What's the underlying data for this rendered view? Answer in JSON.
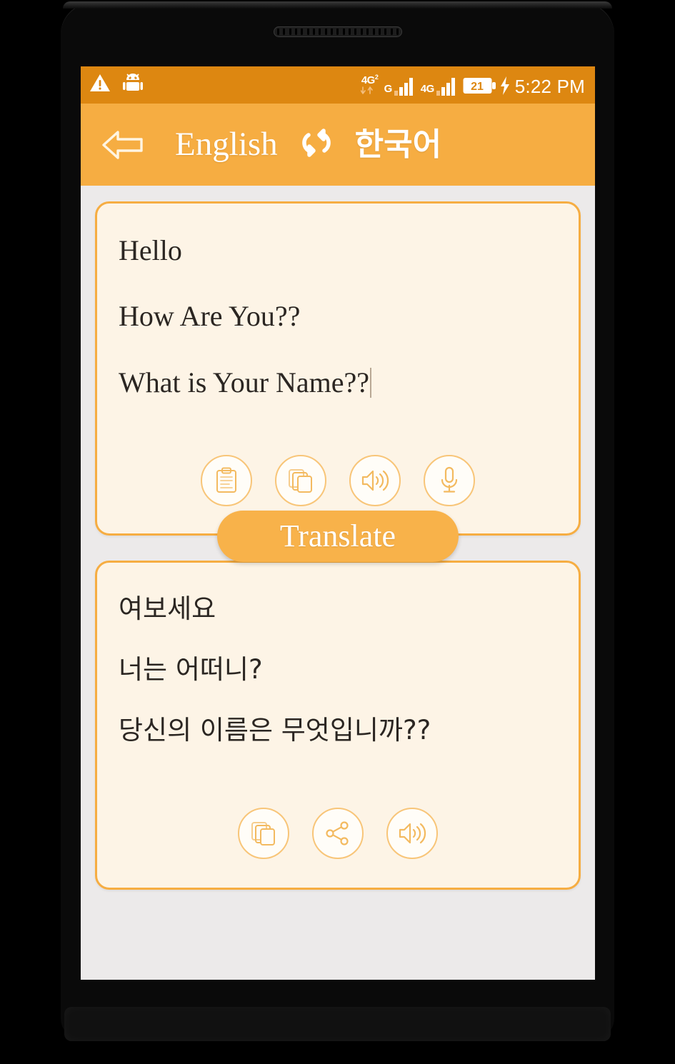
{
  "status_bar": {
    "icons": [
      {
        "name": "warning-triangle-icon",
        "label": "!"
      },
      {
        "name": "android-robot-icon",
        "label": "android"
      }
    ],
    "network_primary": "4G",
    "network_primary_sub": "2",
    "signal_1_label": "G",
    "signal_2_label": "4G",
    "battery_level": "21",
    "charging": true,
    "time": "5:22 PM"
  },
  "app_bar": {
    "back_label": "Back",
    "source_language": "English",
    "swap_label": "Swap languages",
    "target_language": "한국어"
  },
  "input_card": {
    "lines": [
      "Hello",
      "How Are You??",
      "What is Your Name??"
    ],
    "actions": [
      {
        "name": "paste-button",
        "icon": "clipboard-icon",
        "label": "Paste"
      },
      {
        "name": "copy-button",
        "icon": "copy-icon",
        "label": "Copy"
      },
      {
        "name": "speak-button",
        "icon": "speaker-icon",
        "label": "Speak"
      },
      {
        "name": "voice-input-button",
        "icon": "microphone-icon",
        "label": "Voice input"
      }
    ]
  },
  "translate_button": {
    "label": "Translate"
  },
  "output_card": {
    "lines": [
      "여보세요",
      "너는 어떠니?",
      "당신의 이름은 무엇입니까??"
    ],
    "actions": [
      {
        "name": "copy-result-button",
        "icon": "copy-icon",
        "label": "Copy"
      },
      {
        "name": "share-result-button",
        "icon": "share-icon",
        "label": "Share"
      },
      {
        "name": "speak-result-button",
        "icon": "speaker-icon",
        "label": "Speak"
      }
    ]
  },
  "colors": {
    "status_bar": "#dd8711",
    "app_bar": "#f6ad42",
    "accent": "#f8b24a",
    "card_bg": "#fdf4e6",
    "card_border": "#f6ad42",
    "screen_bg": "#eceaea",
    "text": "#2b2622"
  }
}
